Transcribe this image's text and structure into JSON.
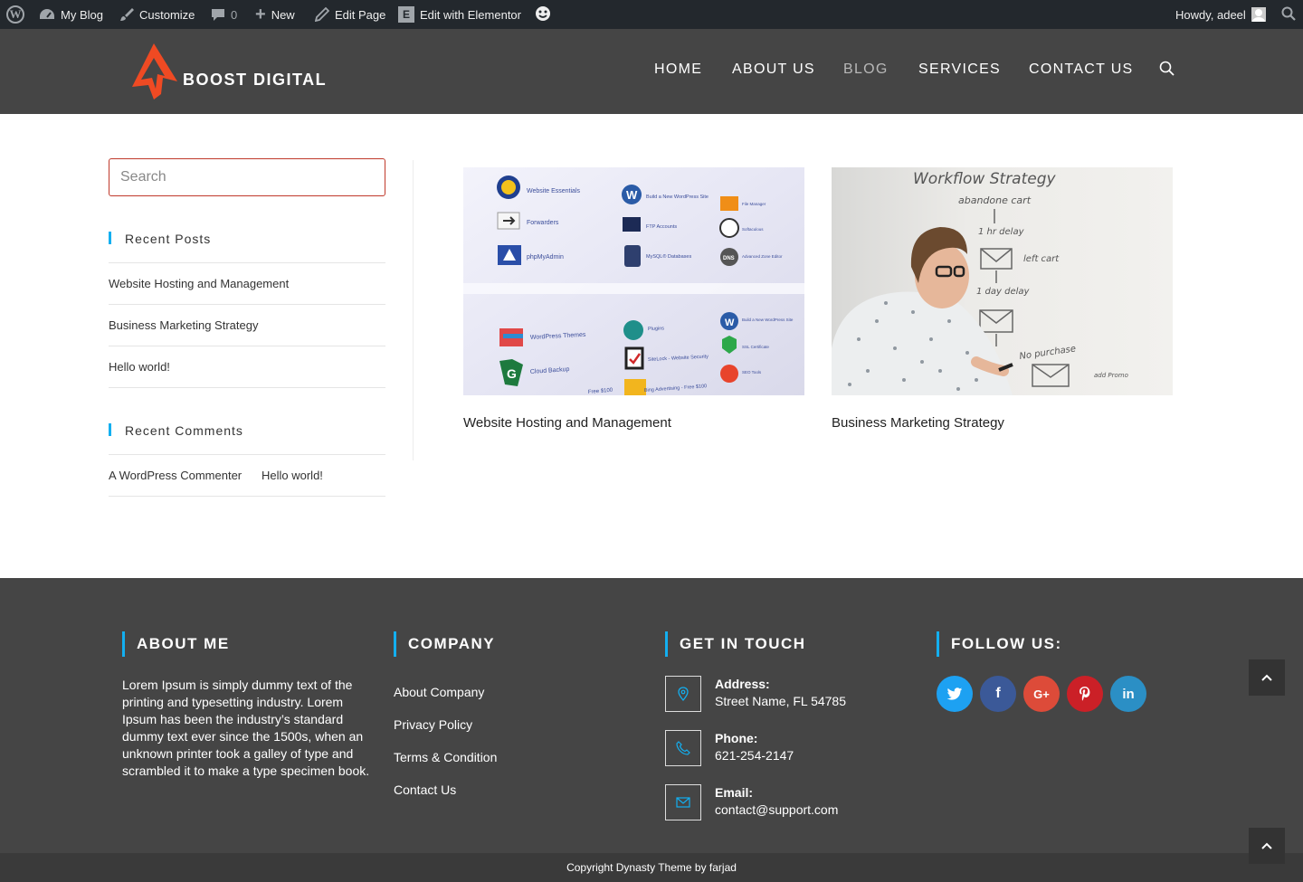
{
  "admin_bar": {
    "site_name": "My Blog",
    "customize": "Customize",
    "comments_count": "0",
    "new": "New",
    "edit_page": "Edit Page",
    "edit_elementor": "Edit with Elementor",
    "greeting": "Howdy, adeel"
  },
  "header": {
    "logo_text": "BOOST DIGITAL",
    "nav": [
      "HOME",
      "ABOUT US",
      "BLOG",
      "SERVICES",
      "CONTACT US"
    ],
    "active_nav": "BLOG"
  },
  "sidebar": {
    "search_placeholder": "Search",
    "recent_posts_title": "Recent Posts",
    "recent_posts": [
      "Website Hosting and Management",
      "Business Marketing Strategy",
      "Hello world!"
    ],
    "recent_comments_title": "Recent Comments",
    "recent_comment": {
      "author": "A WordPress Commenter",
      "post": "Hello world!"
    }
  },
  "posts": [
    {
      "title": "Website Hosting and Management",
      "image_labels": [
        "Website Essentials",
        "Forwarders",
        "phpMyAdmin",
        "Build a New WordPress Site",
        "FTP Accounts",
        "MySQL® Databases",
        "File Manager",
        "Softaculous",
        "Advanced Zone Editor",
        "WordPress Themes",
        "Cloud Backup",
        "Plugins",
        "SiteLock - Website Security",
        "Bing Advertising - Free $100",
        "Build a New WordPress Site",
        "SSL Certificate",
        "SEO Tools",
        "Free $100"
      ]
    },
    {
      "title": "Business Marketing Strategy",
      "image_labels": [
        "Workflow Strategy",
        "abandone cart",
        "1 hr delay",
        "left cart",
        "1 day delay",
        "No purchase",
        "add Promo"
      ]
    }
  ],
  "footer": {
    "about_title": "ABOUT ME",
    "about_text": "Lorem Ipsum is simply dummy text of the printing and typesetting industry. Lorem Ipsum has been the industry’s standard dummy text ever since the 1500s, when an unknown printer took a galley of type and scrambled it to make a type specimen book.",
    "company_title": "COMPANY",
    "company_links": [
      "About Company",
      "Privacy Policy",
      "Terms & Condition",
      "Contact Us"
    ],
    "contact_title": "GET IN TOUCH",
    "address_label": "Address:",
    "address_value": "Street Name, FL 54785",
    "phone_label": "Phone:",
    "phone_value": "621-254-2147",
    "email_label": "Email:",
    "email_value": "contact@support.com",
    "follow_title": "FOLLOW US:",
    "social": [
      {
        "name": "twitter",
        "color": "#1da1f2"
      },
      {
        "name": "facebook",
        "color": "#3b5998"
      },
      {
        "name": "google-plus",
        "color": "#dd4b39"
      },
      {
        "name": "pinterest",
        "color": "#cb2027"
      },
      {
        "name": "linkedin",
        "color": "#2b8fc5"
      }
    ]
  },
  "copyright": "Copyright Dynasty Theme by farjad",
  "colors": {
    "accent": "#13aff0",
    "header_bg": "#454545",
    "admin_bg": "#23282d",
    "logo_orange": "#ef4a23",
    "search_border": "#c0392b"
  }
}
